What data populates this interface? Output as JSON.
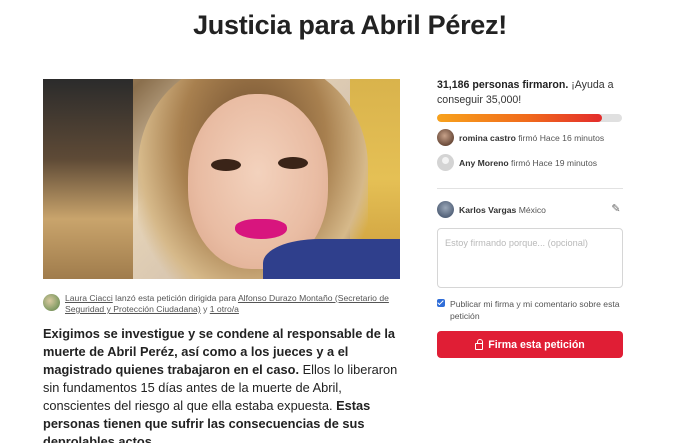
{
  "petition": {
    "title": "Justicia para Abril Pérez!"
  },
  "launcher": {
    "name": "Laura Ciacci",
    "middle": " lanzó esta petición dirigida para ",
    "target": "Alfonso Durazo Montaño (Secretario de Seguridad y Protección Ciudadana)",
    "conj": " y ",
    "others": "1 otro/a"
  },
  "body": {
    "bold1": "Exigimos se investigue y se condene al responsable de la muerte de Abril Peréz, así como a los jueces y a el magistrado quienes trabajaron en el caso.",
    "normal1": " Ellos lo liberaron sin fundamentos 15 días antes de la muerte de Abril, conscientes del riesgo al que ella estaba expuesta. ",
    "bold2": "Estas personas tienen que sufrir las consecuencias de sus deprolables actos."
  },
  "progress": {
    "signed_text": "31,186 personas firmaron.",
    "goal_text": " ¡Ayuda a conseguir 35,000!",
    "signed": 31186,
    "goal": 35000,
    "colors": [
      "#f8a21c",
      "#f06a1c",
      "#e32c2c"
    ]
  },
  "recent_signers": [
    {
      "name": "romina castro",
      "action": " firmó Hace 16 minutos"
    },
    {
      "name": "Any Moreno",
      "action": " firmó Hace 19 minutos"
    }
  ],
  "current_user": {
    "name": "Karlos Vargas",
    "location": "México",
    "edit_icon": "pencil-icon"
  },
  "form": {
    "reason_placeholder": "Estoy firmando porque... (opcional)",
    "publish_label": "Publicar mi firma y mi comentario sobre esta petición",
    "publish_checked": true,
    "sign_button": "Firma esta petición",
    "sign_icon": "lock-icon",
    "accent": "#e01e35"
  }
}
